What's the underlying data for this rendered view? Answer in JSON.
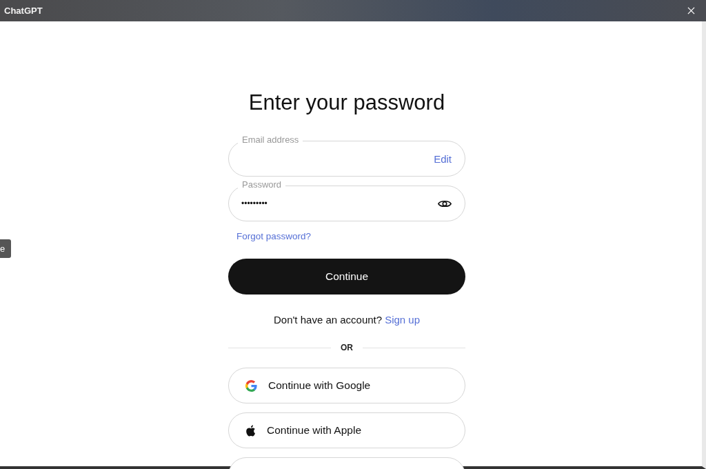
{
  "window": {
    "title": "ChatGPT"
  },
  "side_tab": {
    "label": "e"
  },
  "heading": "Enter your password",
  "email_field": {
    "label": "Email address",
    "action": "Edit"
  },
  "password_field": {
    "label": "Password",
    "value": "•••••••••"
  },
  "forgot_link": "Forgot password?",
  "continue_button": "Continue",
  "signup": {
    "text": "Don't have an account?",
    "link": "Sign up"
  },
  "divider": "OR",
  "providers": [
    {
      "kind": "google",
      "label": "Continue with Google"
    },
    {
      "kind": "apple",
      "label": "Continue with Apple"
    },
    {
      "kind": "partial"
    }
  ]
}
